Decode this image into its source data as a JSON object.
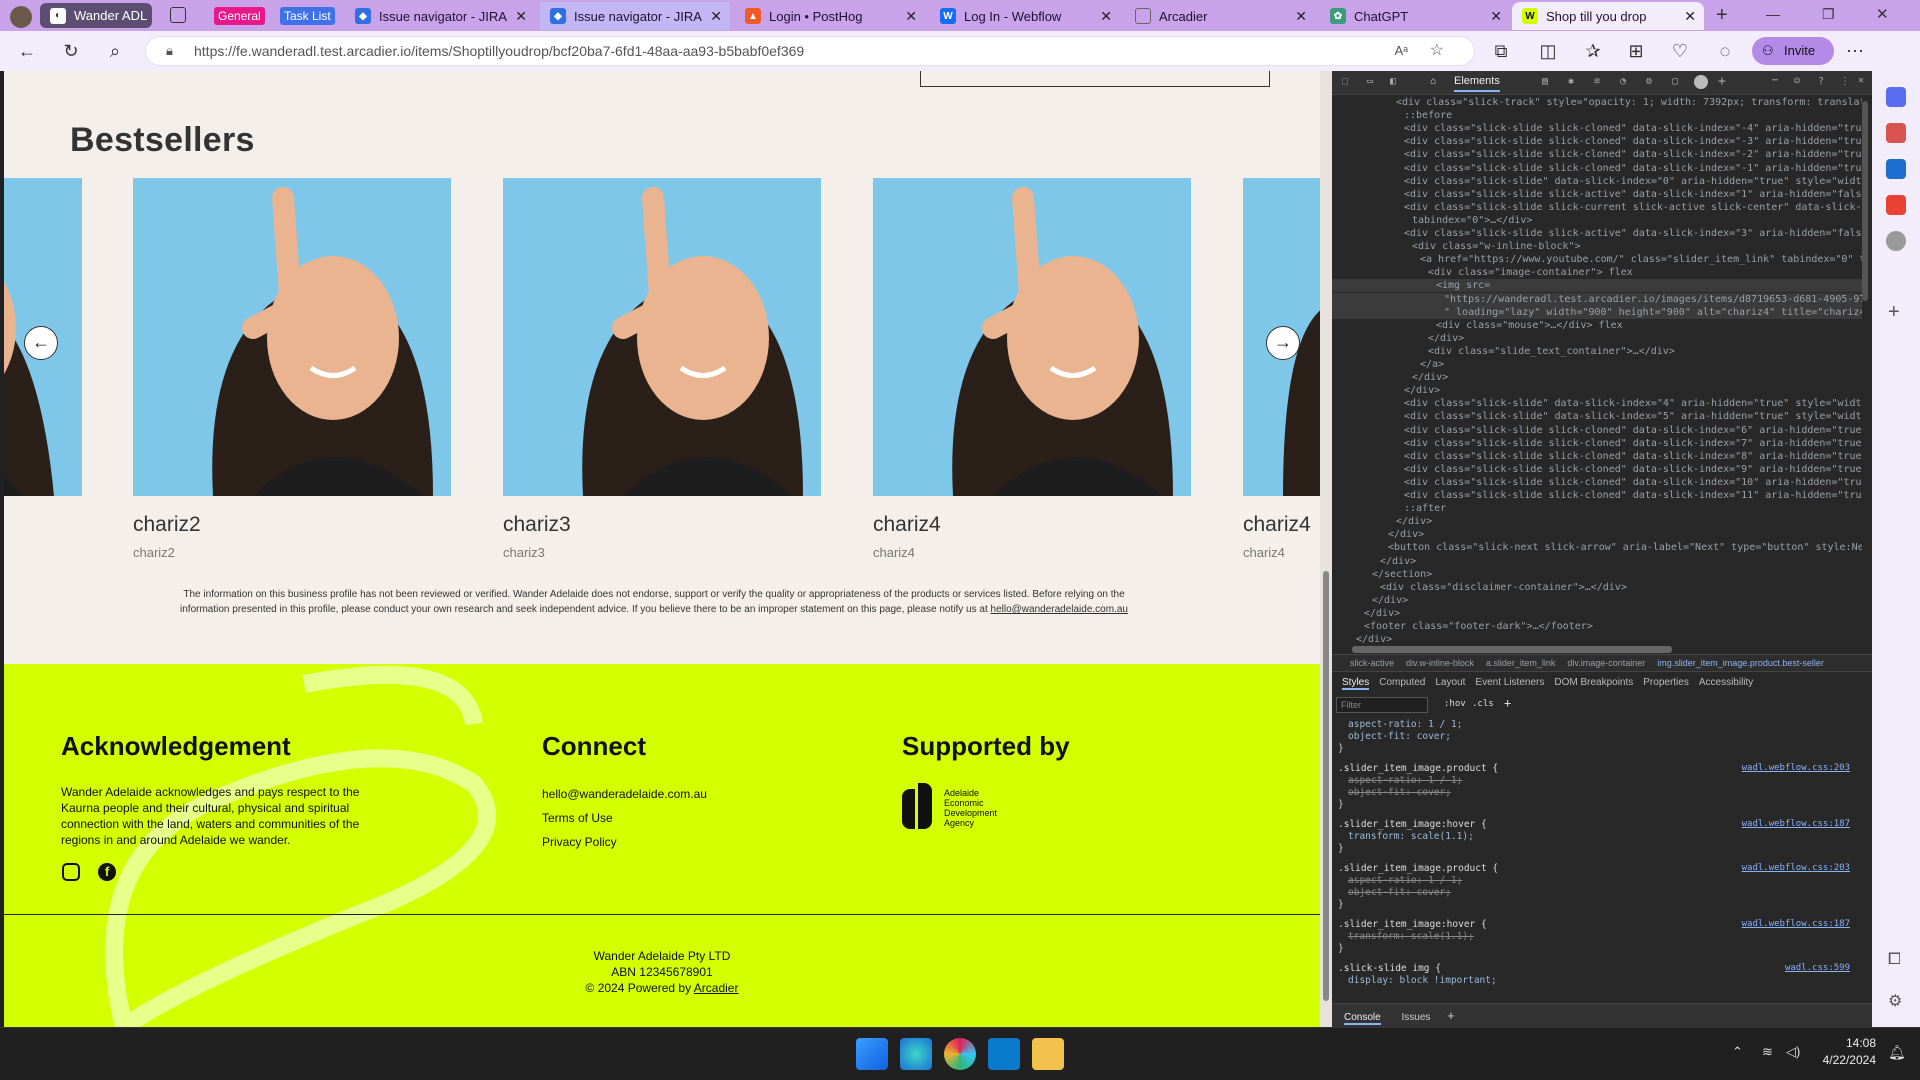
{
  "browser": {
    "tabs": [
      {
        "label": "Wander ADL",
        "color": "#5a5a5a"
      },
      {
        "label": "General",
        "chip": true,
        "chip_color": "#e8178a"
      },
      {
        "label": "Task List",
        "chip": true,
        "chip_color": "#3f71e9"
      },
      {
        "label": "Issue navigator - JIRA",
        "color": "#2f6fe0"
      },
      {
        "label": "Issue navigator - JIRA",
        "color": "#2f6fe0"
      },
      {
        "label": "Login • PostHog",
        "color": "#f05a28"
      },
      {
        "label": "Log In - Webflow",
        "color": "#146ef5"
      },
      {
        "label": "Arcadier",
        "color": "#666"
      },
      {
        "label": "ChatGPT",
        "color": "#3a9c7c"
      },
      {
        "label": "Shop till you drop",
        "color": "#222"
      }
    ],
    "url": "https://fe.wanderadl.test.arcadier.io/items/Shoptillyoudrop/bcf20ba7-6fd1-48aa-aa93-b5babf0ef369",
    "invite_label": "Invite"
  },
  "page": {
    "section_title": "Bestsellers",
    "products": [
      {
        "name": "chariz2",
        "subtitle": "chariz2"
      },
      {
        "name": "chariz3",
        "subtitle": "chariz3"
      },
      {
        "name": "chariz4",
        "subtitle": "chariz4"
      },
      {
        "name": "chariz4",
        "subtitle": "chariz4"
      }
    ],
    "disclaimer_line1": "The information on this business profile has not been reviewed or verified. Wander Adelaide does not endorse, support or verify the quality or appropriateness of the products or services listed. Before relying on the",
    "disclaimer_line2": "information presented in this profile, please conduct your own research and seek independent advice. If you believe there to be an improper statement on this page, please notify us at",
    "disclaimer_email": "hello@wanderadelaide.com.au",
    "footer": {
      "ack_title": "Acknowledgement",
      "ack_text": "Wander Adelaide acknowledges and pays respect to the Kaurna people and their cultural, physical and spiritual connection with the land, waters and communities of the regions in and around Adelaide we wander.",
      "connect_title": "Connect",
      "connect_links": [
        "hello@wanderadelaide.com.au",
        "Terms of Use",
        "Privacy Policy"
      ],
      "supported_title": "Supported by",
      "agency": [
        "Adelaide",
        "Economic",
        "Development",
        "Agency"
      ],
      "company": "Wander Adelaide Pty LTD",
      "abn": "ABN 12345678901",
      "powered": "© 2024 Powered by",
      "powered_link": "Arcadier"
    }
  },
  "devtools": {
    "elements_tab": "Elements",
    "dom_lines": [
      "<div class=\"slick-track\" style=\"opacity: 1; width: 7392px; transform: translate",
      "::before",
      "<div class=\"slick-slide slick-cloned\" data-slick-index=\"-4\" aria-hidden=\"true\"",
      "<div class=\"slick-slide slick-cloned\" data-slick-index=\"-3\" aria-hidden=\"true\"",
      "<div class=\"slick-slide slick-cloned\" data-slick-index=\"-2\" aria-hidden=\"true\"",
      "<div class=\"slick-slide slick-cloned\" data-slick-index=\"-1\" aria-hidden=\"true\"",
      "<div class=\"slick-slide\" data-slick-index=\"0\" aria-hidden=\"true\" style=\"width:",
      "<div class=\"slick-slide slick-active\" data-slick-index=\"1\" aria-hidden=\"false\"",
      "<div class=\"slick-slide slick-current slick-active slick-center\" data-slick-in",
      "tabindex=\"0\">…</div>",
      "<div class=\"slick-slide slick-active\" data-slick-index=\"3\" aria-hidden=\"false\"",
      "<div class=\"w-inline-block\">",
      "<a href=\"https://www.youtube.com/\" class=\"slider_item_link\" tabindex=\"0\" t",
      "<div class=\"image-container\"> flex",
      "<img src=",
      "\"https://wanderadl.test.arcadier.io/images/items/d8719653-d681-4905-97a",
      "\" loading=\"lazy\" width=\"900\" height=\"900\" alt=\"chariz4\" title=\"chariz4\"",
      "<div class=\"mouse\">…</div> flex",
      "</div>",
      "<div class=\"slide_text_container\">…</div>",
      "</a>",
      "</div>",
      "</div>",
      "<div class=\"slick-slide\" data-slick-index=\"4\" aria-hidden=\"true\" style=\"width:",
      "<div class=\"slick-slide\" data-slick-index=\"5\" aria-hidden=\"true\" style=\"width:",
      "<div class=\"slick-slide slick-cloned\" data-slick-index=\"6\" aria-hidden=\"true\"",
      "<div class=\"slick-slide slick-cloned\" data-slick-index=\"7\" aria-hidden=\"true\"",
      "<div class=\"slick-slide slick-cloned\" data-slick-index=\"8\" aria-hidden=\"true\"",
      "<div class=\"slick-slide slick-cloned\" data-slick-index=\"9\" aria-hidden=\"true\"",
      "<div class=\"slick-slide slick-cloned\" data-slick-index=\"10\" aria-hidden=\"true\"",
      "<div class=\"slick-slide slick-cloned\" data-slick-index=\"11\" aria-hidden=\"true\"",
      "::after",
      "</div>",
      "</div>",
      "<button class=\"slick-next slick-arrow\" aria-label=\"Next\" type=\"button\" style:Next",
      "</div>",
      "</section>",
      "<div class=\"disclaimer-container\">…</div>",
      "</div>",
      "</div>",
      "<footer class=\"footer-dark\">…</footer>",
      "</div>"
    ],
    "breadcrumbs": [
      "slick-active",
      "div.w-inline-block",
      "a.slider_item_link",
      "div.image-container",
      "img.slider_item_image.product.best-seller"
    ],
    "style_tabs": [
      "Styles",
      "Computed",
      "Layout",
      "Event Listeners",
      "DOM Breakpoints",
      "Properties",
      "Accessibility"
    ],
    "filter_placeholder": "Filter",
    "hov": ":hov",
    "cls": ".cls",
    "style_lines": [
      {
        "text": "aspect-ratio: 1 / 1;",
        "link": ""
      },
      {
        "text": "object-fit: cover;",
        "link": ""
      },
      {
        "text": "}",
        "link": ""
      },
      {
        "text": ".slider_item_image.product {",
        "link": "wadl.webflow.css:203"
      },
      {
        "text": "aspect-ratio: 1 / 1;",
        "link": "",
        "strike": true
      },
      {
        "text": "object-fit: cover;",
        "link": "",
        "strike": true
      },
      {
        "text": "}",
        "link": ""
      },
      {
        "text": ".slider_item_image:hover {",
        "link": "wadl.webflow.css:187"
      },
      {
        "text": "transform: scale(1.1);",
        "link": ""
      },
      {
        "text": "}",
        "link": ""
      },
      {
        "text": ".slider_item_image.product {",
        "link": "wadl.webflow.css:203"
      },
      {
        "text": "aspect-ratio: 1 / 1;",
        "link": "",
        "strike": true
      },
      {
        "text": "object-fit: cover;",
        "link": "",
        "strike": true
      },
      {
        "text": "}",
        "link": ""
      },
      {
        "text": ".slider_item_image:hover {",
        "link": "wadl.webflow.css:187"
      },
      {
        "text": "transform: scale(1.1);",
        "link": "",
        "strike": true
      },
      {
        "text": "}",
        "link": ""
      },
      {
        "text": ".slick-slide img {",
        "link": "wadl.css:599"
      },
      {
        "text": "display: block !important;",
        "link": ""
      }
    ],
    "console_tabs": [
      "Console",
      "Issues"
    ]
  },
  "taskbar": {
    "time": "14:08",
    "date": "4/22/2024"
  }
}
